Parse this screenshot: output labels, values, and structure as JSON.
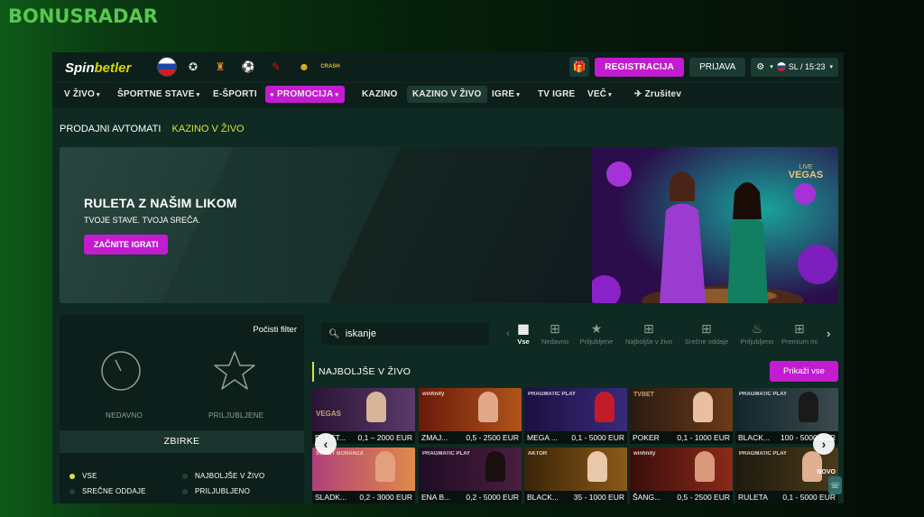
{
  "watermark": "BONUSRADAR",
  "logo": {
    "part1": "Spin",
    "part2": "betler"
  },
  "header": {
    "register_label": "REGISTRACIJA",
    "login_label": "PRIJAVA",
    "lang_time": "SL / 15:23",
    "comp_icons": [
      "champions-league-icon",
      "europa-league-icon",
      "football-icon",
      "brand-icon-1",
      "brand-icon-2",
      "crash-game-icon"
    ],
    "crash_label": "CRASH"
  },
  "nav": {
    "items": [
      {
        "label": "V ŽIVO",
        "caret": true
      },
      {
        "label": "ŠPORTNE STAVE",
        "caret": true
      },
      {
        "label": "E-ŠPORTI",
        "caret": false
      },
      {
        "label": "PROMOCIJA",
        "caret": true
      },
      {
        "label": "KAZINO",
        "caret": false
      },
      {
        "label": "KAZINO V ŽIVO",
        "caret": false
      },
      {
        "label": "IGRE",
        "caret": true
      },
      {
        "label": "TV IGRE",
        "caret": false
      },
      {
        "label": "VEČ",
        "caret": true
      },
      {
        "label": "Zrušitev",
        "caret": false
      }
    ]
  },
  "breadcrumbs": {
    "first": "PRODAJNI AVTOMATI",
    "second": "KAZINO V ŽIVO"
  },
  "banner": {
    "title": "RULETA Z NAŠIM LIKOM",
    "subtitle": "TVOJE STAVE. TVOJA SREČA.",
    "cta": "ZAČNITE IGRATI",
    "badge_top": "LIVE",
    "badge": "VEGAS"
  },
  "filters": {
    "clear": "Počisti filter",
    "recent": "NEDAVNO",
    "favorites": "PRILJUBLJENE",
    "collections_title": "ZBIRKE",
    "collections": [
      {
        "label": "VSE",
        "active": true
      },
      {
        "label": "NAJBOLJŠE V ŽIVO",
        "active": false
      },
      {
        "label": "SREČNE ODDAJE",
        "active": false
      },
      {
        "label": "PRILJUBLJENO",
        "active": false
      }
    ]
  },
  "search": {
    "value": "iskanje"
  },
  "categories": [
    {
      "label": "Vse",
      "icon": "grid-icon",
      "active": true
    },
    {
      "label": "Nedavno",
      "icon": "recent-icon",
      "active": false
    },
    {
      "label": "Priljubljene",
      "icon": "star-icon",
      "active": false
    },
    {
      "label": "Najboljše v živo",
      "icon": "live-tv-icon",
      "active": false
    },
    {
      "label": "Srečne oddaje",
      "icon": "tv-icon",
      "active": false
    },
    {
      "label": "Priljubljeno",
      "icon": "flame-icon",
      "active": false
    },
    {
      "label": "Premium mi",
      "icon": "premium-tv-icon",
      "active": false
    }
  ],
  "section": {
    "title": "NAJBOLJŠE V ŽIVO",
    "show_all": "Prikaži vse"
  },
  "games": [
    {
      "name": "RULET...",
      "limit": "0,1 – 2000 EUR",
      "provider": "VEGAS",
      "color": "#3a1f4a"
    },
    {
      "name": "ZMAJ...",
      "limit": "0,5 - 2500 EUR",
      "provider": "winfinity",
      "color": "#7a2a10"
    },
    {
      "name": "MEGA ...",
      "limit": "0,1 - 5000 EUR",
      "provider": "PRAGMATIC PLAY",
      "color": "#2a1a5a"
    },
    {
      "name": "POKER",
      "limit": "0,1 - 1000 EUR",
      "provider": "TVBET",
      "color": "#3a1a12"
    },
    {
      "name": "BLACK...",
      "limit": "100 - 5000 EUR",
      "provider": "PRAGMATIC PLAY",
      "color": "#1a2a2e"
    },
    {
      "name": "SLADK...",
      "limit": "0,2 - 3000 EUR",
      "provider": "SWEET BONANZA",
      "color": "#b0407a"
    },
    {
      "name": "ENA B...",
      "limit": "0,2 - 5000 EUR",
      "provider": "PRAGMATIC PLAY",
      "color": "#2a1230"
    },
    {
      "name": "BLACK...",
      "limit": "35 - 1000 EUR",
      "provider": "AKTOR",
      "color": "#4a2a0e"
    },
    {
      "name": "ŠANG...",
      "limit": "0,5 - 2500 EUR",
      "provider": "winfinity",
      "color": "#5a1a14"
    },
    {
      "name": "RULETA",
      "limit": "0,1 - 5000 EUR",
      "provider": "PRAGMATIC PLAY",
      "color": "#2a2414",
      "tag": "NOVO"
    }
  ]
}
